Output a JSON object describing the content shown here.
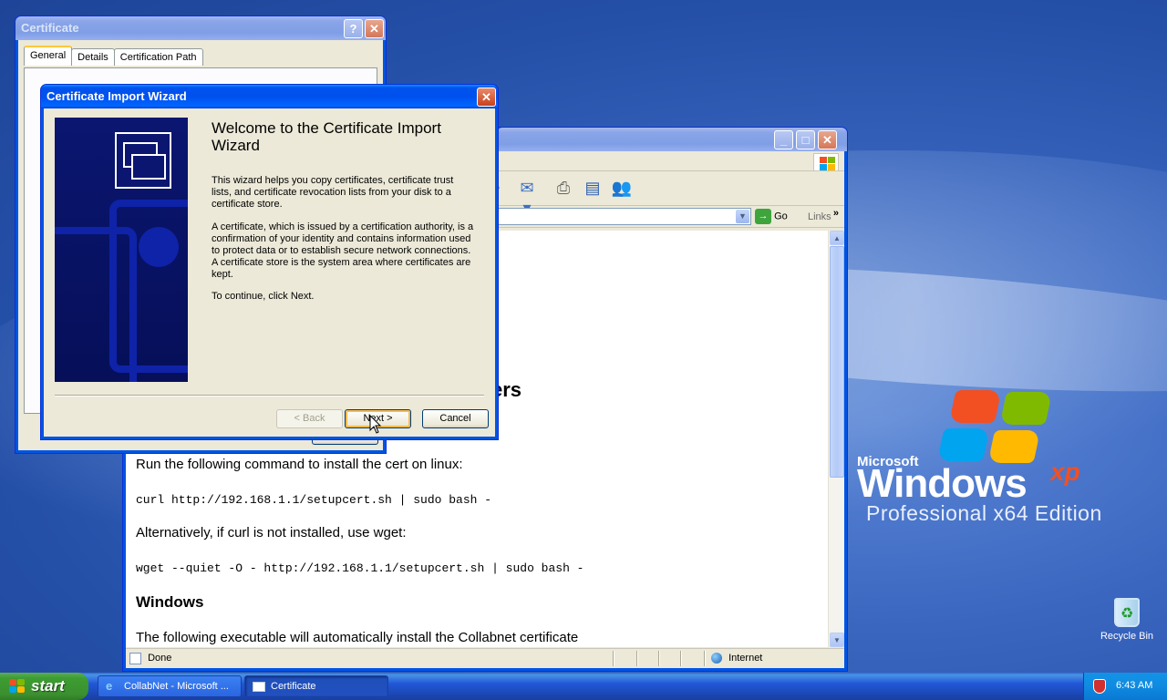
{
  "desktop": {
    "logo_company": "Microsoft",
    "logo_product": "Windows",
    "logo_version": "xp",
    "logo_edition": "Professional x64 Edition",
    "recycle_bin_label": "Recycle Bin"
  },
  "browser": {
    "address_go_label": "Go",
    "links_label": "Links",
    "page": {
      "partial_heading": "ers",
      "linux_instruction": "Run the following command to install the cert on linux:",
      "linux_command": "curl http://192.168.1.1/setupcert.sh | sudo bash -",
      "alt_instruction": "Alternatively, if curl is not installed, use wget:",
      "wget_command": "wget --quiet -O - http://192.168.1.1/setupcert.sh | sudo bash -",
      "windows_heading": "Windows",
      "windows_text": "The following executable will automatically install the Collabnet certificate"
    },
    "status": {
      "left": "Done",
      "zone": "Internet"
    }
  },
  "certificate_dialog": {
    "title": "Certificate",
    "tabs": [
      "General",
      "Details",
      "Certification Path"
    ]
  },
  "wizard": {
    "title": "Certificate Import Wizard",
    "heading": "Welcome to the Certificate Import Wizard",
    "para1": "This wizard helps you copy certificates, certificate trust lists, and certificate revocation lists from your disk to a certificate store.",
    "para2": "A certificate, which is issued by a certification authority, is a confirmation of your identity and contains information used to protect data or to establish secure network connections. A certificate store is the system area where certificates are kept.",
    "para3": "To continue, click Next.",
    "back_label": "< Back",
    "next_label": "Next >",
    "cancel_label": "Cancel"
  },
  "taskbar": {
    "start_label": "start",
    "tasks": [
      {
        "label": "CollabNet - Microsoft ...",
        "active": false
      },
      {
        "label": "Certificate",
        "active": true
      }
    ],
    "clock": "6:43 AM"
  }
}
